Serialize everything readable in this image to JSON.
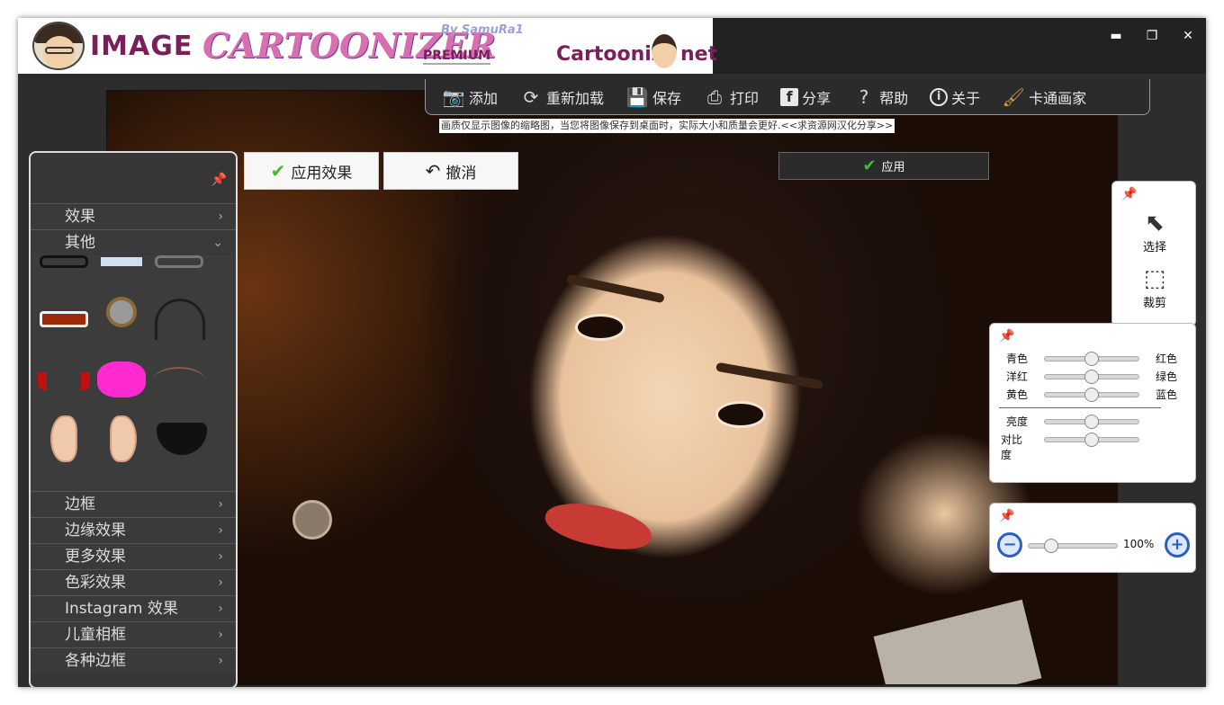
{
  "app": {
    "logo": {
      "image_word": "IMAGE",
      "cartoonizer_word": "CARTOONIZER",
      "by_line": "By SamuRa1",
      "premium": "PREMIUM",
      "site_left": "Cartoonize",
      "site_right": "net"
    },
    "window_controls": [
      "▬",
      "❐",
      "✕"
    ]
  },
  "toolbar": {
    "items": [
      {
        "label": "添加",
        "icon": "camera-icon"
      },
      {
        "label": "重新加载",
        "icon": "reload-icon"
      },
      {
        "label": "保存",
        "icon": "save-icon"
      },
      {
        "label": "打印",
        "icon": "print-icon"
      },
      {
        "label": "分享",
        "icon": "facebook-icon"
      },
      {
        "label": "帮助",
        "icon": "help-icon"
      },
      {
        "label": "关于",
        "icon": "info-icon"
      },
      {
        "label": "卡通画家",
        "icon": "brush-icon"
      }
    ]
  },
  "info_line": "画质仅显示图像的缩略图，当您将图像保存到桌面时，实际大小和质量会更好.<<求资源网汉化分享>>",
  "actions": {
    "apply_effect": "应用效果",
    "undo": "撤消",
    "apply": "应用"
  },
  "left_panel": {
    "top_sections": [
      {
        "label": "效果",
        "chevron": "›"
      },
      {
        "label": "其他",
        "chevron": "⌄"
      }
    ],
    "bottom_sections": [
      {
        "label": "边框"
      },
      {
        "label": "边缘效果"
      },
      {
        "label": "更多效果"
      },
      {
        "label": "色彩效果"
      },
      {
        "label": "Instagram 效果"
      },
      {
        "label": "儿童相框"
      },
      {
        "label": "各种边框"
      }
    ]
  },
  "tools": {
    "select": "选择",
    "crop": "裁剪"
  },
  "color_adjust": {
    "rows": [
      {
        "left": "青色",
        "right": "红色",
        "value": 0.5
      },
      {
        "left": "洋红",
        "right": "绿色",
        "value": 0.5
      },
      {
        "left": "黄色",
        "right": "蓝色",
        "value": 0.5
      }
    ],
    "brightness": {
      "label": "亮度",
      "value": 0.5
    },
    "contrast": {
      "label": "对比度",
      "value": 0.5
    }
  },
  "zoom": {
    "value_text": "100%",
    "level": 0.25
  }
}
